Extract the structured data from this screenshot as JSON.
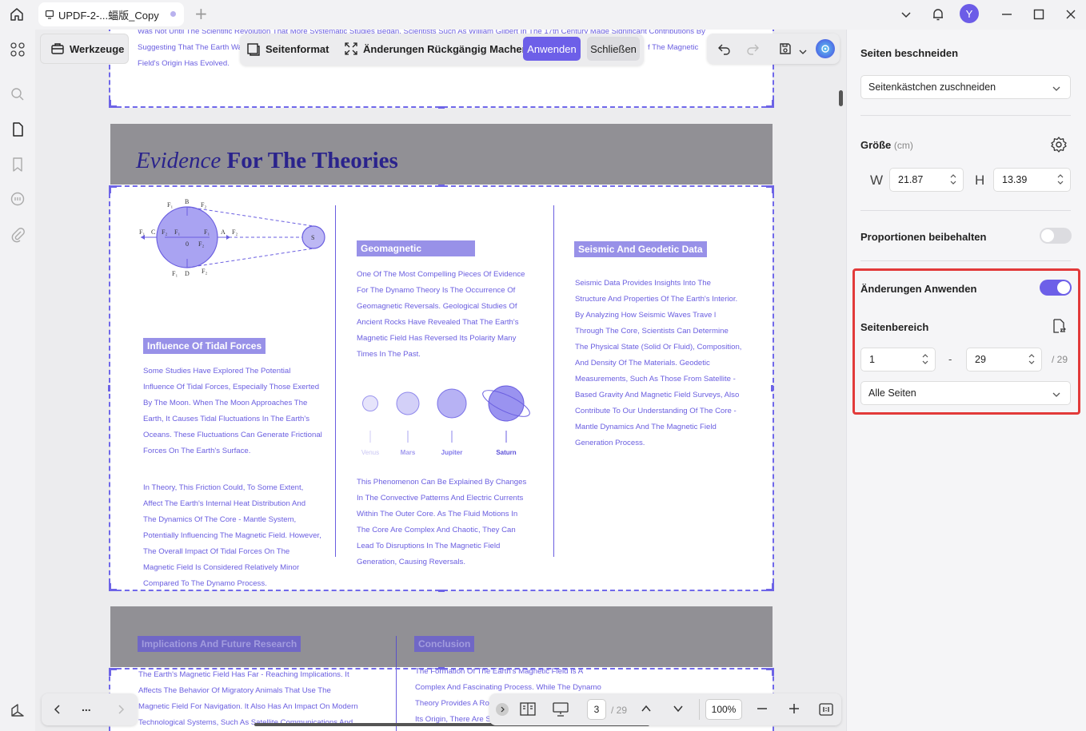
{
  "titlebar": {
    "tab_title": "UPDF-2-...蝠版_Copy",
    "avatar_letter": "Y"
  },
  "toolbar": {
    "werkzeuge": "Werkzeuge",
    "seitenformat": "Seitenformat",
    "rueckgaengig": "Änderungen Rückgängig Machen",
    "anwenden": "Anwenden",
    "schliessen": "Schließen"
  },
  "page_top": {
    "lines": [
      "Was Not Until The Scientific Revolution That More Systematic Studies Began. Scientists Such As William Gilbert In The 17th Century Made Significant Contributions By",
      "Suggesting That The Earth Was",
      "Field's Origin Has Evolved."
    ],
    "tail_right": "f The Magnetic"
  },
  "page_main": {
    "title_italic": "Evidence",
    "title_bold": "For The Theories",
    "diagram_labels": [
      "F₁",
      "B",
      "F₂",
      "F₁",
      "C",
      "F₂",
      "F₁",
      "F₁",
      "A",
      "F₂",
      "0",
      "F₂",
      "F₁",
      "D",
      "F₂",
      "S"
    ],
    "col1": {
      "heading": "Influence Of Tidal Forces",
      "para1": [
        "Some Studies Have Explored The Potential",
        "Influence Of Tidal Forces, Especially Those Exerted",
        "By The Moon. When The Moon Approaches The",
        "Earth, It Causes Tidal Fluctuations In The Earth's",
        "Oceans. These Fluctuations Can Generate Frictional",
        "Forces On The Earth's Surface."
      ],
      "para2": [
        " In Theory, This Friction Could, To Some Extent,",
        "Affect The Earth's Internal Heat Distribution And",
        "The Dynamics Of The Core - Mantle System,",
        "Potentially Influencing The Magnetic Field. However,",
        "The Overall Impact Of Tidal Forces On The",
        "Magnetic Field Is Considered Relatively Minor",
        "Compared To The Dynamo Process."
      ]
    },
    "col2": {
      "heading": "Geomagnetic",
      "para1": [
        "One Of The Most Compelling Pieces Of Evidence",
        "For The Dynamo Theory Is The Occurrence Of",
        "Geomagnetic Reversals. Geological Studies Of",
        "Ancient Rocks Have Revealed That The Earth's",
        "Magnetic Field Has Reversed Its Polarity Many",
        "Times In The Past."
      ],
      "planets": [
        "Venus",
        "Mars",
        "Jupiter",
        "Saturn"
      ],
      "para2": [
        "This Phenomenon Can Be Explained By Changes",
        "In The Convective Patterns And Electric Currents",
        "Within The Outer Core. As The Fluid Motions In",
        "The Core Are Complex And Chaotic, They Can",
        "Lead To Disruptions In The Magnetic Field",
        "Generation, Causing Reversals."
      ]
    },
    "col3": {
      "heading": "Seismic And Geodetic Data",
      "para1": [
        "Seismic Data Provides Insights Into The",
        "Structure And Properties Of The Earth's Interior.",
        "By Analyzing How Seismic Waves Trave l",
        "Through The Core, Scientists Can Determine",
        "The Physical State (Solid Or Fluid), Composition,",
        "And Density Of The Materials. Geodetic",
        "Measurements, Such As Those From Satellite -",
        "Based Gravity And Magnetic Field Surveys, Also",
        "Contribute To Our Understanding Of The Core -",
        "Mantle Dynamics And The Magnetic Field",
        "Generation Process."
      ]
    }
  },
  "page_next": {
    "left_heading": "Implications And Future Research",
    "right_heading": "Conclusion",
    "left_lines": [
      "The Earth's Magnetic Field Has Far - Reaching Implications. It",
      "Affects The Behavior Of Migratory Animals That Use The",
      "Magnetic Field For Navigation. It Also Has An Impact On Modern",
      "Technological Systems, Such As Satellite Communications And"
    ],
    "right_lines": [
      "The Formation Of The Earth's Magnetic Field Is A",
      "Complex And Fascinating Process. While The Dynamo",
      "Theory Provides A Rob",
      "Its Origin, There Are S"
    ]
  },
  "bottom": {
    "current_page": "3",
    "total_pages": "/ 29",
    "zoom": "100%",
    "more": "..."
  },
  "right_panel": {
    "title": "Seiten beschneiden",
    "crop_mode": "Seitenkästchen zuschneiden",
    "size_label": "Größe",
    "size_unit": "(cm)",
    "w_label": "W",
    "w_value": "21.87",
    "h_label": "H",
    "h_value": "13.39",
    "keep_proportions": "Proportionen beibehalten",
    "keep_proportions_on": false,
    "apply_changes": "Änderungen Anwenden",
    "apply_changes_on": true,
    "page_range": "Seitenbereich",
    "range_from": "1",
    "range_dash": "-",
    "range_to": "29",
    "range_total": "/ 29",
    "range_select": "Alle Seiten"
  },
  "colors": {
    "accent": "#6d5fe8",
    "page_text": "#6a5ee0",
    "highlight_border": "#e23a3a"
  }
}
